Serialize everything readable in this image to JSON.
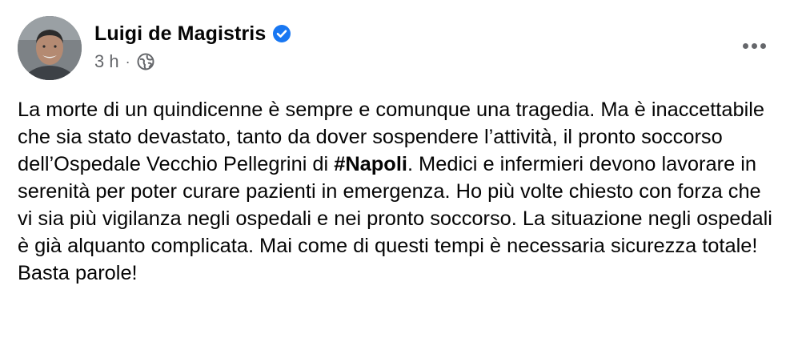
{
  "post": {
    "author": "Luigi de Magistris",
    "verified_icon": "verified-badge-icon",
    "timestamp": "3 h",
    "separator": "·",
    "audience_icon": "globe-icon",
    "more_icon": "more-options-icon",
    "text_before_hashtag": "La morte di un quindicenne è sempre e comunque una tragedia. Ma è inaccettabile che sia stato devastato, tanto da dover sospendere l’attività, il pronto soccorso dell’Ospedale Vecchio Pellegrini di ",
    "hashtag": "#Napoli",
    "text_after_hashtag": ". Medici e infermieri devono lavorare in serenità per poter curare pazienti in emergenza. Ho più volte chiesto con forza che vi sia più vigilanza negli ospedali e nei pronto soccorso. La situazione negli ospedali è già alquanto complicata. Mai come di questi tempi è necessaria sicurezza totale! Basta parole!"
  },
  "colors": {
    "verified_blue": "#1877f2",
    "secondary_text": "#65676b",
    "primary_text": "#050505"
  }
}
